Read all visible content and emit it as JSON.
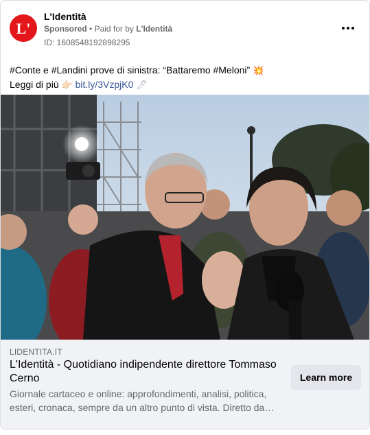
{
  "post": {
    "page_name": "L'Identità",
    "sponsored_label": "Sponsored",
    "separator": "•",
    "paid_for_prefix": "Paid for by",
    "advertiser": "L'Identità",
    "ad_id": "ID: 1608548192898295",
    "avatar_letter": "L'",
    "more_icon": "more-horizontal-icon",
    "text": {
      "line1": "#Conte e #Landini prove di sinistra: “Battaremo #Meloni”",
      "emoji1": "💥",
      "read_more": "Leggi di più",
      "emoji2": "👉🏻",
      "link": "bit.ly/3VzpjK0",
      "emoji3": "🖊"
    }
  },
  "photo": {
    "subject_icon": "news-photo"
  },
  "link_preview": {
    "domain": "LIDENTITA.IT",
    "title": "L'Identità - Quotidiano indipendente direttore Tommaso Cerno",
    "description": "Giornale cartaceo e online: approfondimenti, analisi, politica, esteri, cronaca, sempre da un altro punto di vista. Diretto da…",
    "cta_label": "Learn more"
  },
  "colors": {
    "brand_red": "#e3161c",
    "link_blue": "#385898",
    "secondary_text": "#65676b",
    "preview_bg": "#f0f2f5",
    "button_bg": "#e4e6eb"
  }
}
